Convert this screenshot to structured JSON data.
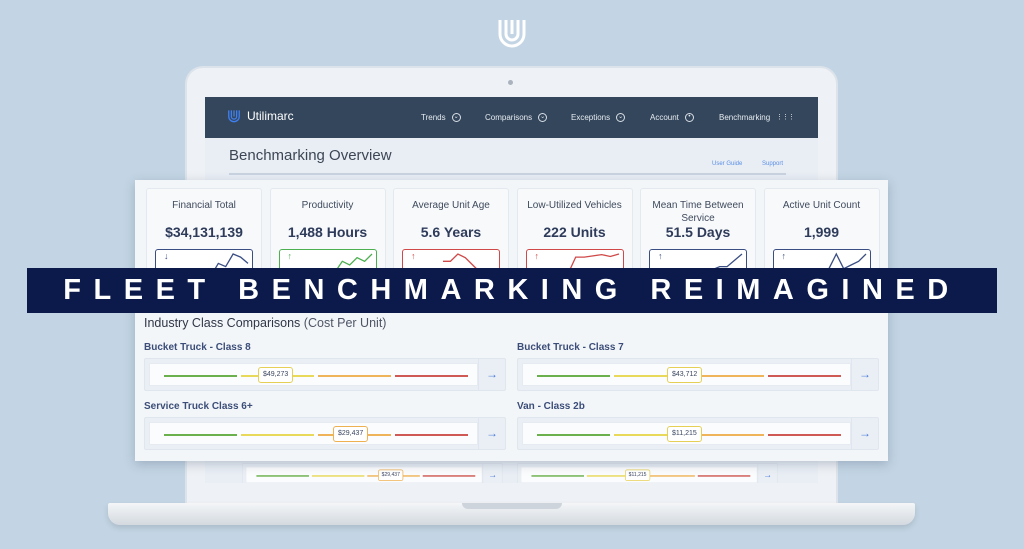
{
  "nav": {
    "brand": "Utilimarc",
    "items": [
      {
        "label": "Trends",
        "icon": "chevron-circle"
      },
      {
        "label": "Comparisons",
        "icon": "chevron-circle"
      },
      {
        "label": "Exceptions",
        "icon": "chevron-circle"
      },
      {
        "label": "Account",
        "icon": "user-circle"
      },
      {
        "label": "Benchmarking",
        "icon": "grid"
      }
    ]
  },
  "page": {
    "title": "Benchmarking Overview",
    "links": [
      "User Guide",
      "Support"
    ]
  },
  "cards": [
    {
      "title": "Financial Total",
      "value": "$34,131,139",
      "trend": "down",
      "color": "#3a4e84",
      "spark": [
        3,
        4,
        2,
        6,
        5,
        9,
        8,
        6
      ]
    },
    {
      "title": "Productivity",
      "value": "1,488 Hours",
      "trend": "up",
      "color": "#4caf50",
      "spark": [
        2,
        4,
        3,
        6,
        5,
        7,
        6,
        8
      ]
    },
    {
      "title": "Average Unit Age",
      "value": "5.6 Years",
      "trend": "up",
      "color": "#d04848",
      "spark": [
        6,
        6,
        8,
        7,
        5,
        3,
        2,
        2
      ]
    },
    {
      "title": "Low-Utilized Vehicles",
      "value": "222 Units",
      "trend": "up",
      "color": "#d04848",
      "spark": [
        1,
        7,
        7,
        7.4,
        7.8,
        7.2,
        8
      ]
    },
    {
      "title": "Mean Time Between Service",
      "value": "51.5 Days",
      "trend": "up",
      "color": "#3a4e84",
      "spark": [
        1,
        1.5,
        2,
        3,
        4,
        4,
        6,
        8
      ]
    },
    {
      "title": "Active Unit Count",
      "value": "1,999",
      "trend": "up",
      "color": "#3a4e84",
      "spark": [
        1,
        2,
        3,
        7,
        3,
        4,
        5,
        7
      ]
    }
  ],
  "banner": "FLEET BENCHMARKING REIMAGINED",
  "comparisons": {
    "title": "Industry Class Comparisons",
    "subtitle": "(Cost Per Unit)",
    "items": [
      {
        "label": "Bucket Truck - Class 8",
        "value": "$49,273",
        "position": 0.38,
        "pill_color": "#e6cf55"
      },
      {
        "label": "Bucket Truck - Class 7",
        "value": "$43,712",
        "position": 0.5,
        "pill_color": "#e6cf55"
      },
      {
        "label": "Service Truck Class 6+",
        "value": "$29,437",
        "position": 0.63,
        "pill_color": "#edb152"
      },
      {
        "label": "Van - Class 2b",
        "value": "$11,215",
        "position": 0.5,
        "pill_color": "#e6cf55"
      }
    ]
  },
  "colors": {
    "nav": "#34465b",
    "banner": "#0b1a4a",
    "green": "#6ab04c",
    "yellow": "#e8d95a",
    "orange": "#efb45a",
    "red": "#cf5a55"
  }
}
